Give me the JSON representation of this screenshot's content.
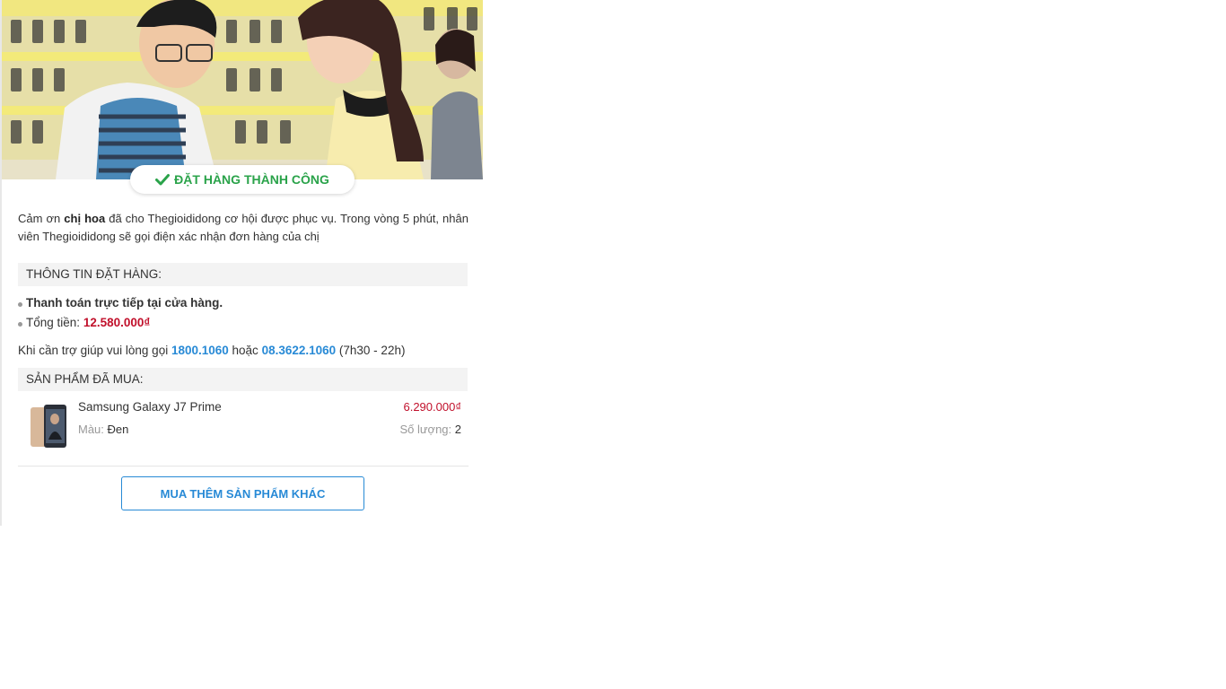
{
  "banner": {
    "status_text": "ĐẶT HÀNG THÀNH CÔNG",
    "status_icon": "check-icon",
    "accent_color": "#2aa34a"
  },
  "thanks": {
    "prefix": "Cảm ơn ",
    "customer": "chị hoa",
    "message": " đã cho Thegioididong cơ hội được phục vụ. Trong vòng 5 phút, nhân viên Thegioididong sẽ gọi điện xác nhận đơn hàng của chị"
  },
  "order_info": {
    "heading": "THÔNG TIN ĐẶT HÀNG:",
    "payment": "Thanh toán trực tiếp tại cửa hàng.",
    "total_label": "Tổng tiền: ",
    "total_value": "12.580.000₫"
  },
  "support": {
    "prefix": "Khi cần trợ giúp vui lòng gọi ",
    "phone1": "1800.1060",
    "middle": " hoặc ",
    "phone2": "08.3622.1060",
    "hours": " (7h30 - 22h)"
  },
  "products": {
    "heading": "SẢN PHẨM ĐÃ MUA:",
    "items": [
      {
        "name": "Samsung Galaxy J7 Prime",
        "price": "6.290.000₫",
        "color_label": "Màu: ",
        "color_value": "Đen",
        "qty_label": "Số lượng: ",
        "qty_value": "2"
      }
    ]
  },
  "buy_more_button": "MUA THÊM SẢN PHẨM KHÁC",
  "colors": {
    "price": "#c1102b",
    "link": "#288ad6",
    "success": "#2aa34a"
  }
}
